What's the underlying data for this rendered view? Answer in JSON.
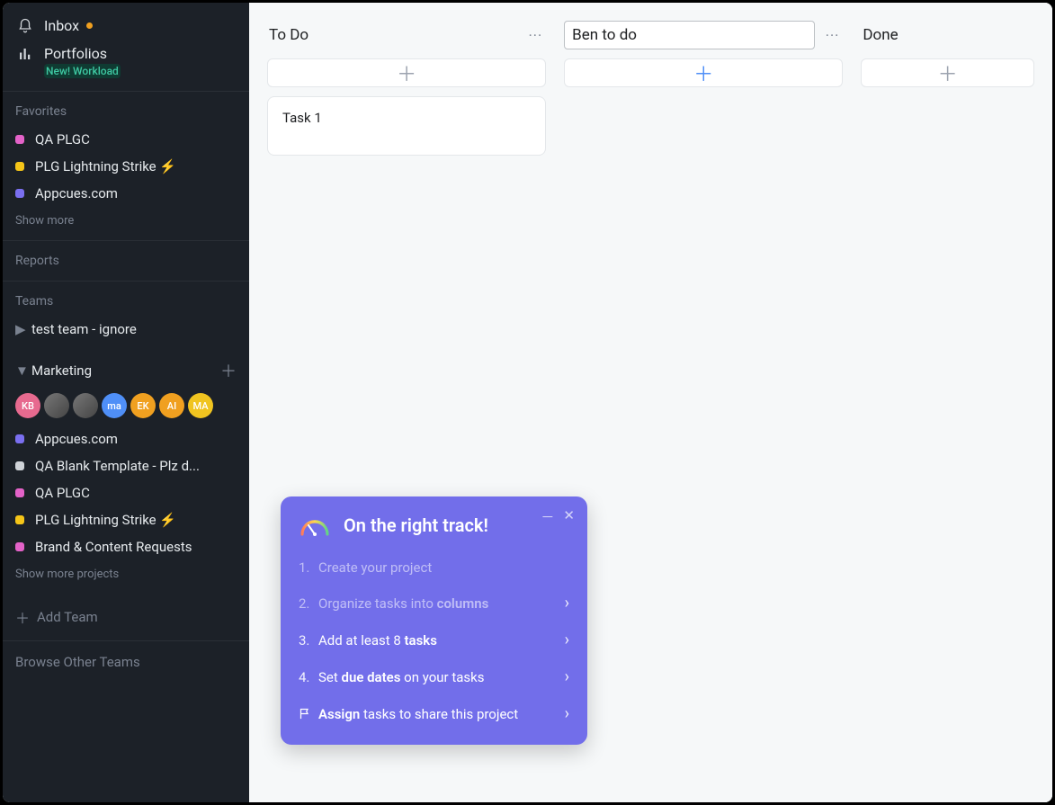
{
  "sidebar": {
    "inbox_label": "Inbox",
    "portfolios_label": "Portfolios",
    "portfolios_badge": "New! Workload",
    "favorites_header": "Favorites",
    "favorites": [
      {
        "label": "QA PLGC",
        "color": "#e362c8"
      },
      {
        "label": "PLG Lightning Strike ⚡️",
        "color": "#f5c518"
      },
      {
        "label": "Appcues.com",
        "color": "#7a6ff0"
      }
    ],
    "show_more_label": "Show more",
    "reports_header": "Reports",
    "teams_header": "Teams",
    "teams": [
      {
        "label": "test team - ignore",
        "expanded": false
      },
      {
        "label": "Marketing",
        "expanded": true
      }
    ],
    "marketing_avatars": [
      {
        "initials": "KB",
        "bg": "#e76a8f"
      },
      {
        "initials": "",
        "bg": "#333",
        "photo": true
      },
      {
        "initials": "",
        "bg": "#555",
        "photo": true
      },
      {
        "initials": "ma",
        "bg": "#4f8ff7"
      },
      {
        "initials": "EK",
        "bg": "#f0a020"
      },
      {
        "initials": "AI",
        "bg": "#f0a020"
      },
      {
        "initials": "MA",
        "bg": "#f0c420"
      }
    ],
    "marketing_projects": [
      {
        "label": "Appcues.com",
        "color": "#7a6ff0"
      },
      {
        "label": "QA Blank Template - Plz d...",
        "color": "#cfd3d8"
      },
      {
        "label": "QA PLGC",
        "color": "#e362c8"
      },
      {
        "label": "PLG Lightning Strike ⚡️",
        "color": "#f5c518"
      },
      {
        "label": "Brand & Content Requests",
        "color": "#e362c8"
      }
    ],
    "show_more_projects_label": "Show more projects",
    "add_team_label": "Add Team",
    "browse_teams_label": "Browse Other Teams"
  },
  "board": {
    "columns": [
      {
        "title": "To Do",
        "editing": false,
        "add_blue": false,
        "cards": [
          "Task 1"
        ]
      },
      {
        "title": "Ben to do",
        "editing": true,
        "add_blue": true,
        "cards": []
      },
      {
        "title": "Done",
        "editing": false,
        "add_blue": false,
        "cards": []
      }
    ]
  },
  "popup": {
    "title": "On the right track!",
    "items": [
      {
        "num": "1.",
        "html": "Create your project",
        "done": true,
        "chevron": false
      },
      {
        "num": "2.",
        "html": "Organize tasks into <b>columns</b>",
        "done": true,
        "chevron": true
      },
      {
        "num": "3.",
        "html": "Add at least 8 <b>tasks</b>",
        "done": false,
        "chevron": true
      },
      {
        "num": "4.",
        "html": "Set <b>due dates</b> on your tasks",
        "done": false,
        "chevron": true
      },
      {
        "num": "flag",
        "html": "<b>Assign</b> tasks to share this project",
        "done": false,
        "chevron": true
      }
    ]
  }
}
